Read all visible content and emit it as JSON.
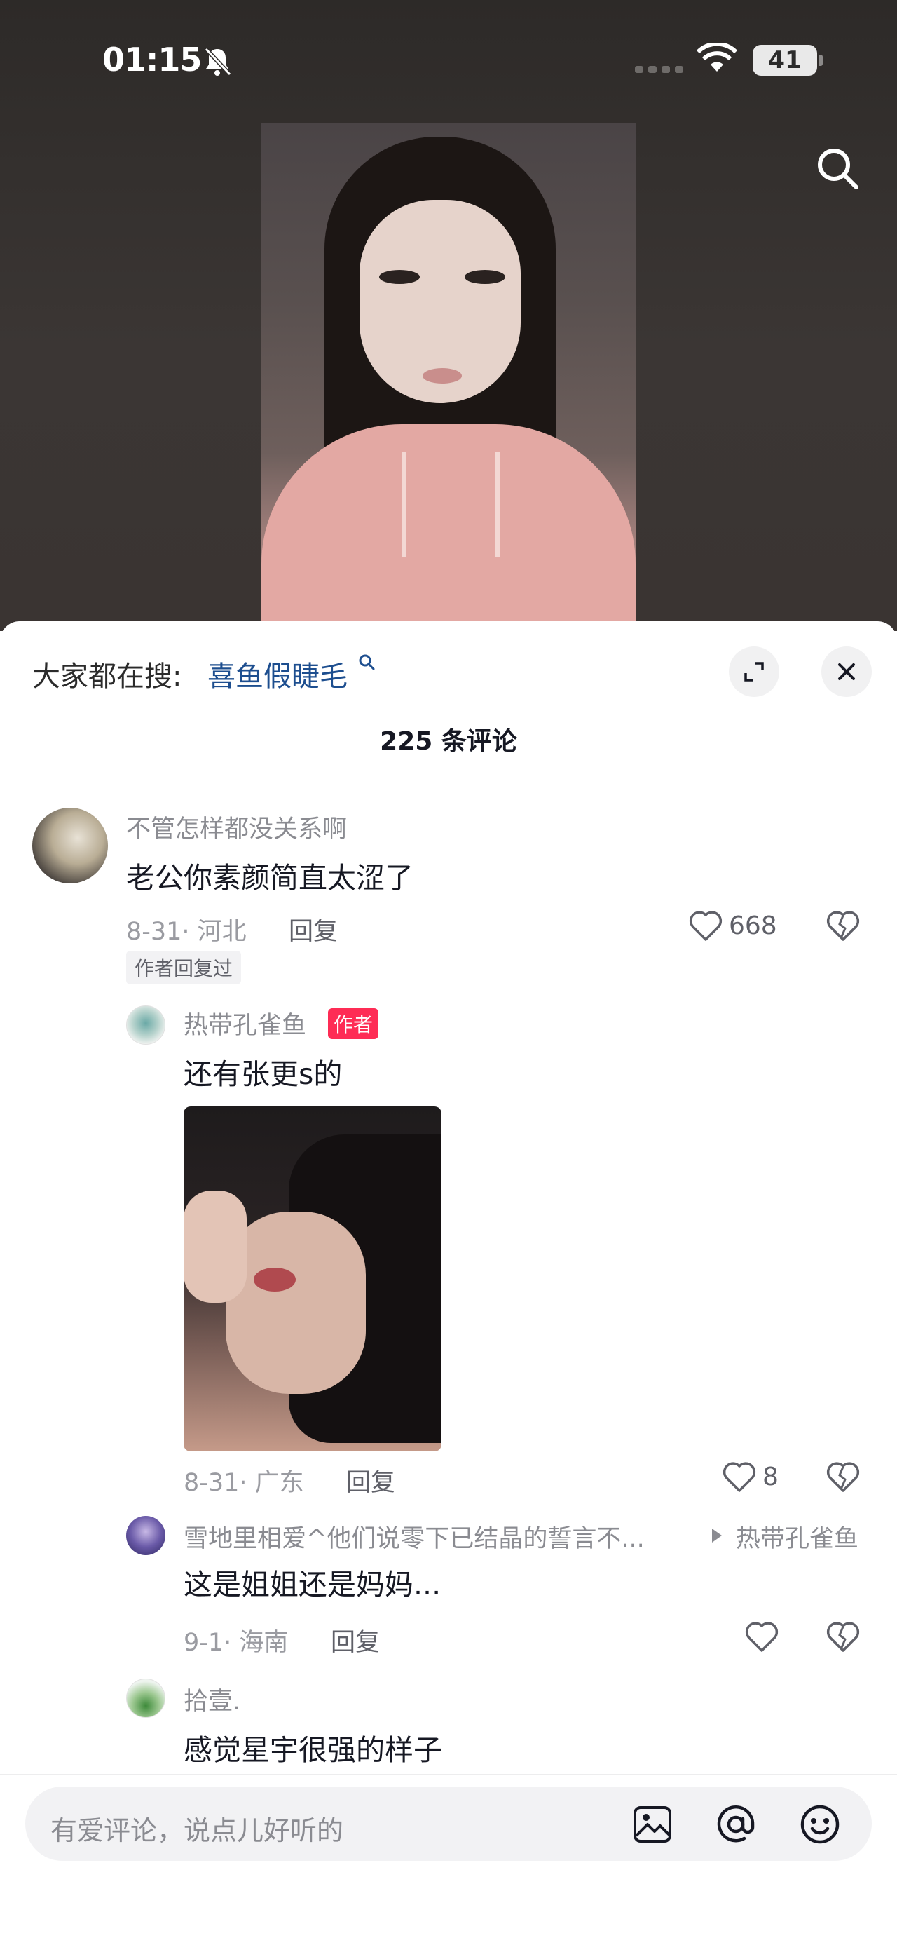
{
  "status_bar": {
    "time": "01:15",
    "battery": "41",
    "icons": [
      "bell-slash-icon",
      "signal-dots-icon",
      "wifi-icon",
      "battery-icon"
    ]
  },
  "video": {
    "search_icon": "search-icon"
  },
  "sheet": {
    "hot_search_label": "大家都在搜:",
    "hot_search_term": "喜鱼假睫毛",
    "comment_count_title": "225 条评论",
    "expand_icon": "expand-icon",
    "close_icon": "close-icon"
  },
  "comments": [
    {
      "username": "不管怎样都没关系啊",
      "text": "老公你素颜简直太涩了",
      "date_location": "8-31· 河北",
      "reply_label": "回复",
      "likes": "668",
      "badge": "作者回复过"
    }
  ],
  "replies": [
    {
      "username": "热带孔雀鱼",
      "author_tag": "作者",
      "text": "还有张更s的",
      "date_location": "8-31· 广东",
      "reply_label": "回复",
      "likes": "8",
      "has_image": true
    },
    {
      "username": "雪地里相爱^他们说零下已结晶的誓言不...",
      "reply_to": "热带孔雀鱼",
      "text": "这是姐姐还是妈妈...",
      "date_location": "9-1· 海南",
      "reply_label": "回复",
      "likes": ""
    },
    {
      "username": "拾壹.",
      "text": "感觉星宇很强的样子"
    }
  ],
  "input_bar": {
    "placeholder": "有爱评论，说点儿好听的",
    "icons": [
      "image-icon",
      "at-icon",
      "emoji-icon"
    ]
  },
  "colors": {
    "accent_red": "#fe2c55",
    "hot_term_blue": "#1d4e8f",
    "text_primary": "#161823",
    "text_secondary": "#8a8b91"
  }
}
